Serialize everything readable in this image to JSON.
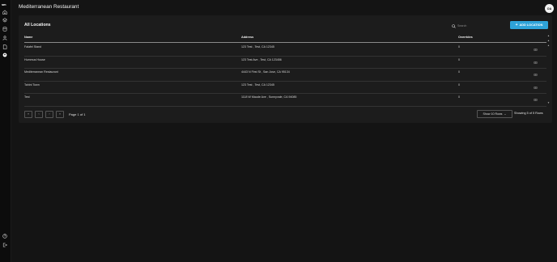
{
  "app": {
    "logo_text": "sm"
  },
  "header": {
    "title": "Mediterranean Restaurant",
    "avatar_initials": "OA"
  },
  "sidebar": {
    "items": [
      {
        "icon": "home-icon"
      },
      {
        "icon": "layers-icon"
      },
      {
        "icon": "database-icon"
      },
      {
        "icon": "user-icon"
      },
      {
        "icon": "document-icon"
      },
      {
        "icon": "location-icon"
      }
    ],
    "bottom": [
      {
        "icon": "help-icon"
      },
      {
        "icon": "logout-icon"
      }
    ]
  },
  "locations": {
    "title": "All Locations",
    "search_placeholder": "Search",
    "add_button": "ADD LOCATION",
    "columns": {
      "name": "Name",
      "address": "Address",
      "overrides": "Overrides"
    },
    "rows": [
      {
        "name": "Falafel Stand",
        "address": "123 Test , Test, CA 12345",
        "overrides": "0"
      },
      {
        "name": "Hummus House",
        "address": "123 Test Ave , Test, CA 123456",
        "overrides": "0"
      },
      {
        "name": "Mediterranean Restaurant",
        "address": "4443 N First St , San Jose, CA 95134",
        "overrides": "0"
      },
      {
        "name": "Tahini Town",
        "address": "123 Test , Test, CA 12345",
        "overrides": "0"
      },
      {
        "name": "Test",
        "address": "1118 W Maude Ave , Sunnyvale, CA 94085",
        "overrides": "0"
      }
    ],
    "pagination": {
      "page_info": "Page 1 of 1",
      "rows_select": "Show 10 Rows",
      "showing": "Showing 5 of 5 Rows"
    }
  },
  "colors": {
    "accent": "#2ea3d9",
    "background": "#141414",
    "card": "#1c1c1c"
  }
}
